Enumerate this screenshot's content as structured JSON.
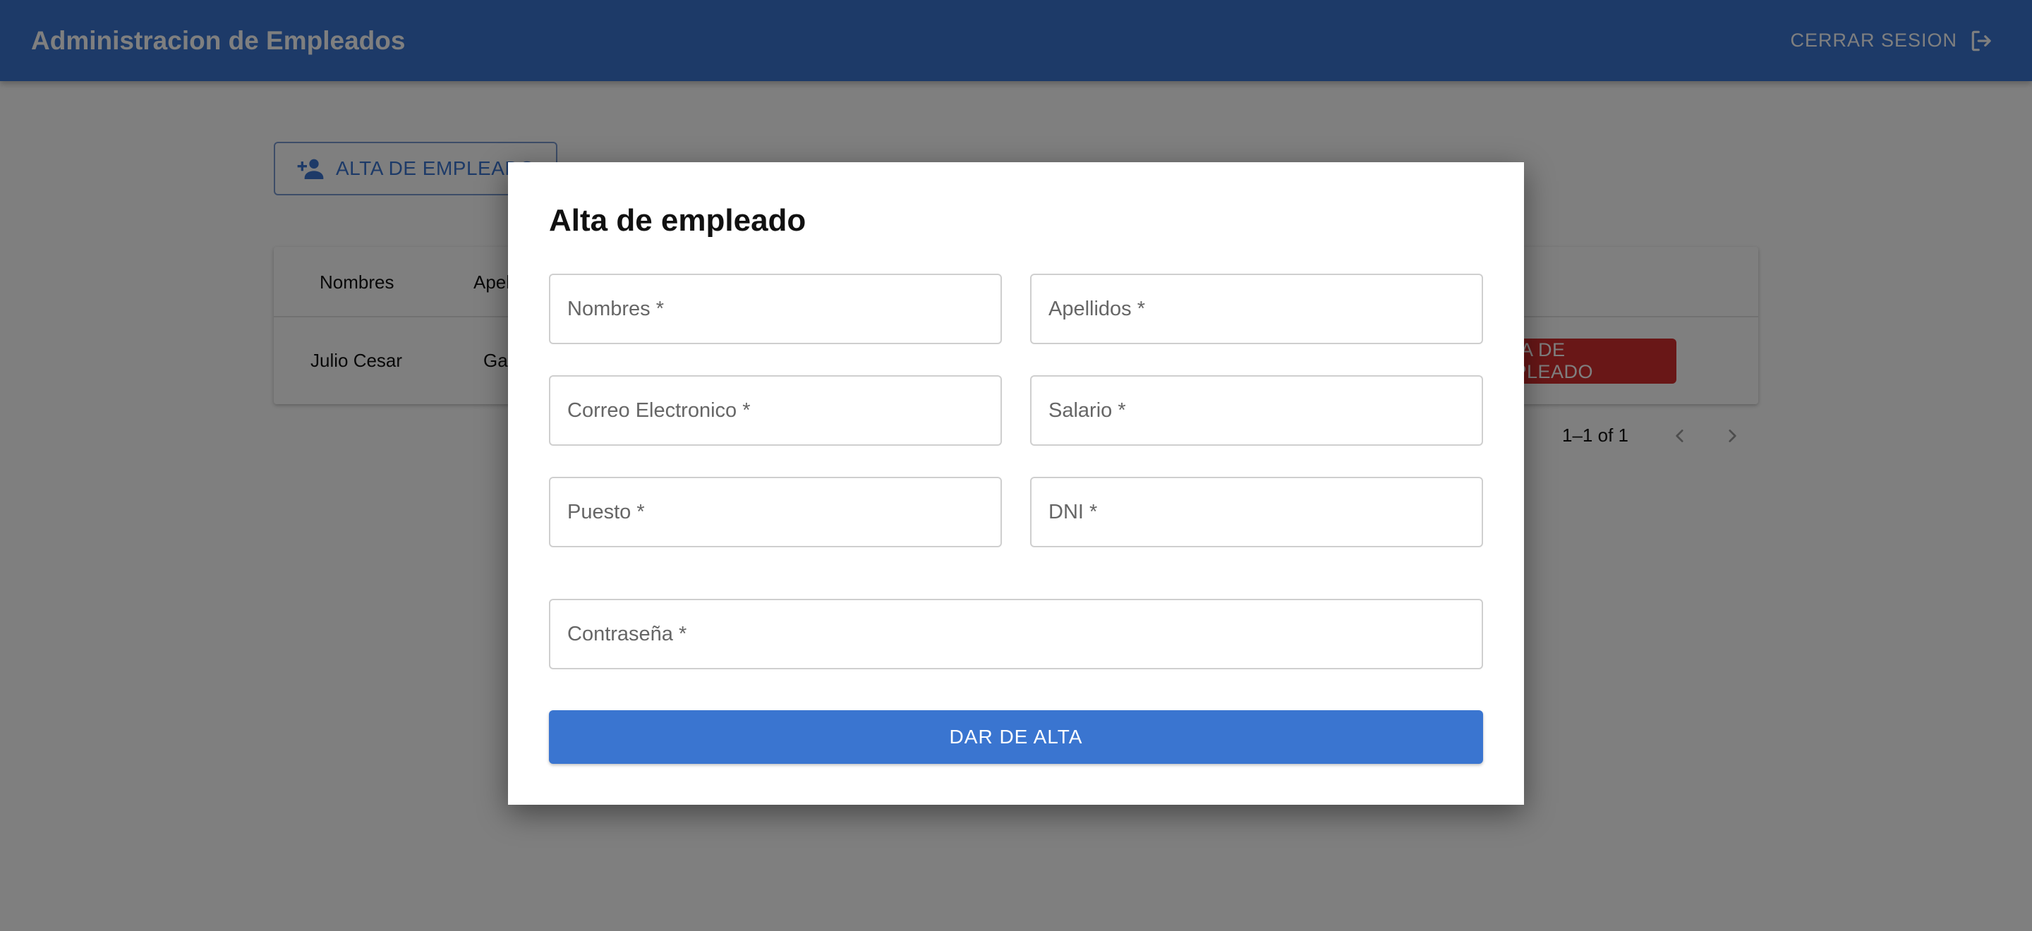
{
  "appbar": {
    "title": "Administracion de Empleados",
    "logout_label": "CERRAR SESION"
  },
  "page": {
    "add_button_label": "ALTA DE EMPLEADO",
    "table": {
      "headers": [
        "Nombres",
        "Apellidos"
      ],
      "rows": [
        {
          "nombres": "Julio Cesar",
          "apellidos": "Ga"
        }
      ],
      "delete_button_label": "BAJA DE EMPLEADO"
    },
    "pagination": {
      "range": "1–1 of 1"
    }
  },
  "dialog": {
    "title": "Alta de empleado",
    "fields": {
      "nombres": "Nombres *",
      "apellidos": "Apellidos *",
      "correo": "Correo Electronico *",
      "salario": "Salario *",
      "puesto": "Puesto *",
      "dni": "DNI *",
      "contrasena": "Contraseña *"
    },
    "submit_label": "DAR DE ALTA"
  },
  "colors": {
    "primary": "#3a75d0",
    "danger": "#d32f2f"
  },
  "icons": {
    "logout": "logout-icon",
    "add_user": "person-add-icon",
    "prev": "chevron-left-icon",
    "next": "chevron-right-icon"
  }
}
